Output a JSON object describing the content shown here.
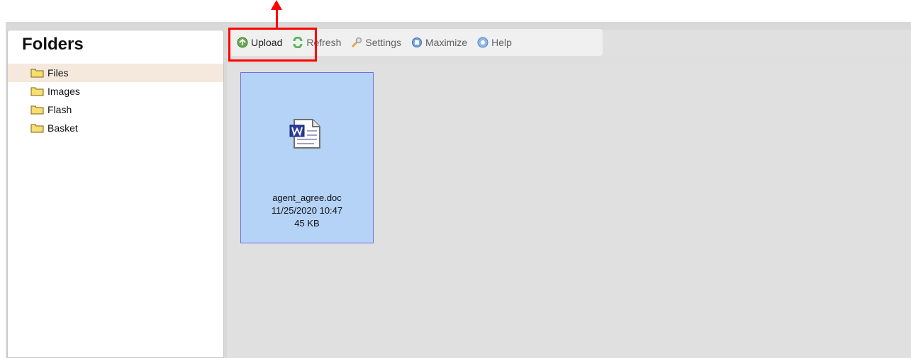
{
  "folders": {
    "title": "Folders",
    "items": [
      {
        "label": "Files",
        "selected": true
      },
      {
        "label": "Images",
        "selected": false
      },
      {
        "label": "Flash",
        "selected": false
      },
      {
        "label": "Basket",
        "selected": false
      }
    ]
  },
  "toolbar": {
    "upload_label": "Upload",
    "refresh_label": "Refresh",
    "settings_label": "Settings",
    "maximize_label": "Maximize",
    "help_label": "Help"
  },
  "file": {
    "name": "agent_agree.doc",
    "modified": "11/25/2020 10:47",
    "size": "45 KB",
    "icon": "word-document-icon"
  },
  "colors": {
    "highlight": "#ff0000",
    "selected_folder": "#f4e9dc",
    "selected_file": "#b5d3f7"
  }
}
